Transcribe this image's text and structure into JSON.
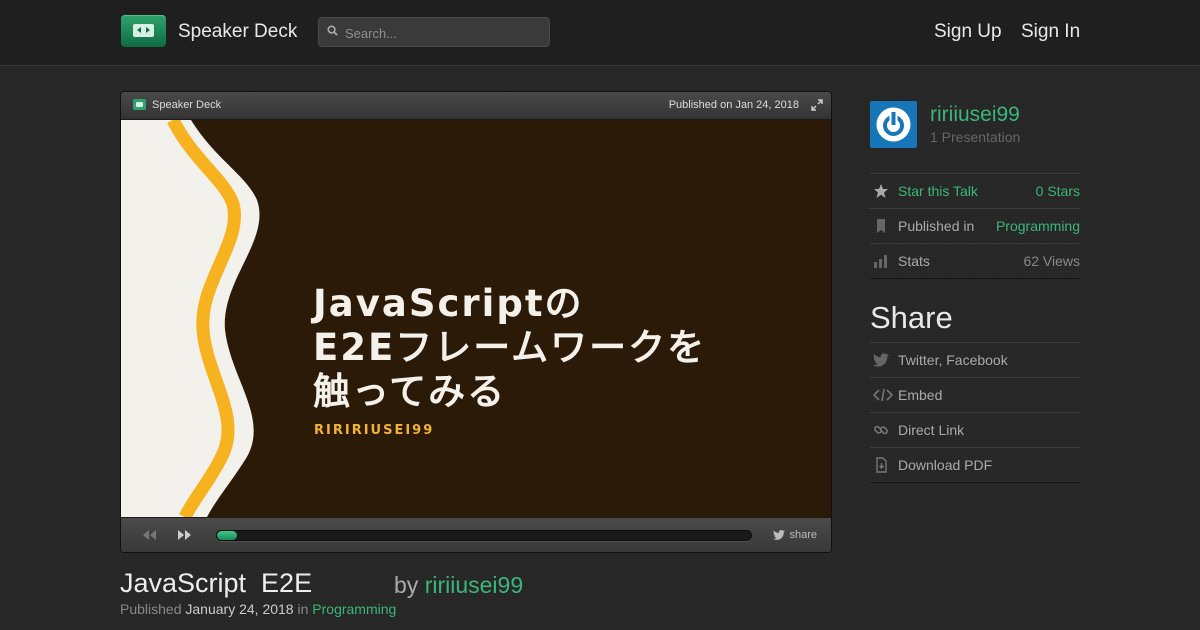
{
  "header": {
    "brand": "Speaker Deck",
    "search_placeholder": "Search...",
    "sign_up": "Sign Up",
    "sign_in": "Sign In"
  },
  "player": {
    "brand": "Speaker Deck",
    "published_on": "Published on Jan 24, 2018",
    "slide": {
      "title_line1": "JavaScriptの",
      "title_line2": "E2Eフレームワークを",
      "title_line3": "触ってみる",
      "author": "RIRIRIUSEI99",
      "colors": {
        "background": "#2b1a08",
        "stripe": "#f6b21f",
        "edge": "#f3f1ec"
      }
    },
    "progress_fraction": 0.034,
    "share_label": "share"
  },
  "talk": {
    "title": "JavaScript  E2E",
    "by_prefix": "by",
    "author": "ririiusei99",
    "published_prefix": "Published",
    "published_date": "January 24, 2018",
    "in_word": "in",
    "category": "Programming"
  },
  "sidebar": {
    "username": "ririiusei99",
    "presentation_count": "1 Presentation",
    "star_label": "Star this Talk",
    "stars_value": "0 Stars",
    "published_in_label": "Published in",
    "published_in_value": "Programming",
    "stats_label": "Stats",
    "stats_value": "62 Views",
    "share_heading": "Share",
    "share_links": [
      "Twitter, Facebook",
      "Embed",
      "Direct Link",
      "Download PDF"
    ]
  }
}
